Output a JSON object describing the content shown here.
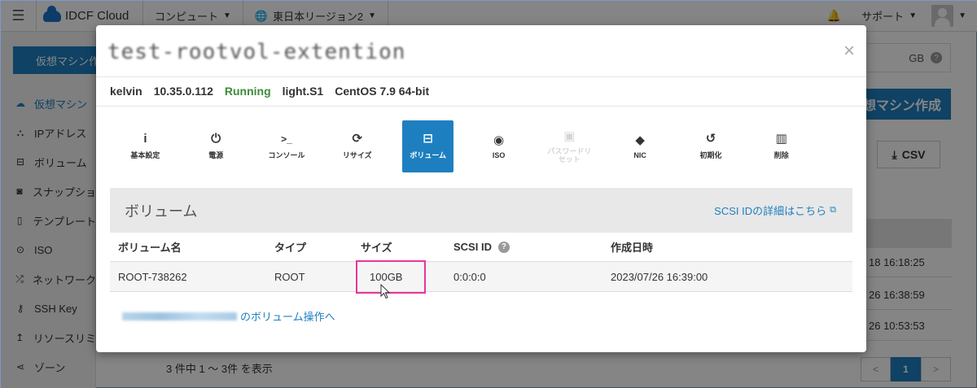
{
  "topbar": {
    "brand": "IDCF Cloud",
    "nav_compute": "コンピュート",
    "nav_region": "東日本リージョン2",
    "support": "サポート"
  },
  "sidebar": {
    "create_button": "仮想マシン作",
    "items": [
      {
        "label": "仮想マシン",
        "icon": "cloud-icon"
      },
      {
        "label": "IPアドレス",
        "icon": "sitemap-icon"
      },
      {
        "label": "ボリューム",
        "icon": "drive-icon"
      },
      {
        "label": "スナップショ",
        "icon": "camera-icon"
      },
      {
        "label": "テンプレート",
        "icon": "file-icon"
      },
      {
        "label": "ISO",
        "icon": "disc-icon"
      },
      {
        "label": "ネットワーク",
        "icon": "network-icon"
      },
      {
        "label": "SSH Key",
        "icon": "key-icon"
      },
      {
        "label": "リソースリミ",
        "icon": "arrow-icon"
      },
      {
        "label": "ゾーン",
        "icon": "share-icon"
      }
    ]
  },
  "background": {
    "storage_suffix": "GB",
    "create_vm_button": "想マシン作成",
    "csv_button": "CSV",
    "rows": [
      "18 16:18:25",
      "26 16:38:59",
      "26 10:53:53"
    ],
    "footer": "3 件中 1 ～ 3件 を表示",
    "pager": [
      "<",
      "1",
      ">"
    ]
  },
  "modal": {
    "title": "test-rootvol-extention",
    "close": "×",
    "info": {
      "user": "kelvin",
      "ip": "10.35.0.112",
      "status": "Running",
      "plan": "light.S1",
      "os": "CentOS 7.9 64-bit"
    },
    "tools": [
      {
        "label": "基本設定",
        "icon": "info-icon",
        "glyph": "ℹ"
      },
      {
        "label": "電源",
        "icon": "power-icon",
        "glyph": "⏻"
      },
      {
        "label": "コンソール",
        "icon": "terminal-icon",
        "glyph": ">_"
      },
      {
        "label": "リサイズ",
        "icon": "refresh-icon",
        "glyph": "⟳"
      },
      {
        "label": "ボリューム",
        "icon": "drive-icon",
        "glyph": "▭"
      },
      {
        "label": "ISO",
        "icon": "disc-icon",
        "glyph": "◉"
      },
      {
        "label": "パスワードリセット",
        "icon": "lock-icon",
        "glyph": "🔒"
      },
      {
        "label": "NIC",
        "icon": "tag-icon",
        "glyph": "◆"
      },
      {
        "label": "初期化",
        "icon": "history-icon",
        "glyph": "↺"
      },
      {
        "label": "削除",
        "icon": "trash-icon",
        "glyph": "🗑"
      }
    ],
    "volume": {
      "heading": "ボリューム",
      "scsi_link": "SCSI IDの詳細はこちら",
      "columns": [
        "ボリューム名",
        "タイプ",
        "サイズ",
        "SCSI ID",
        "作成日時"
      ],
      "row": {
        "name": "ROOT-738262",
        "type": "ROOT",
        "size": "100GB",
        "scsi_id": "0:0:0:0",
        "created": "2023/07/26 16:39:00"
      }
    },
    "operation_link": "のボリューム操作へ"
  },
  "colors": {
    "accent": "#1e7fc0",
    "running": "#3c8b3c",
    "highlight": "#e8359a"
  }
}
